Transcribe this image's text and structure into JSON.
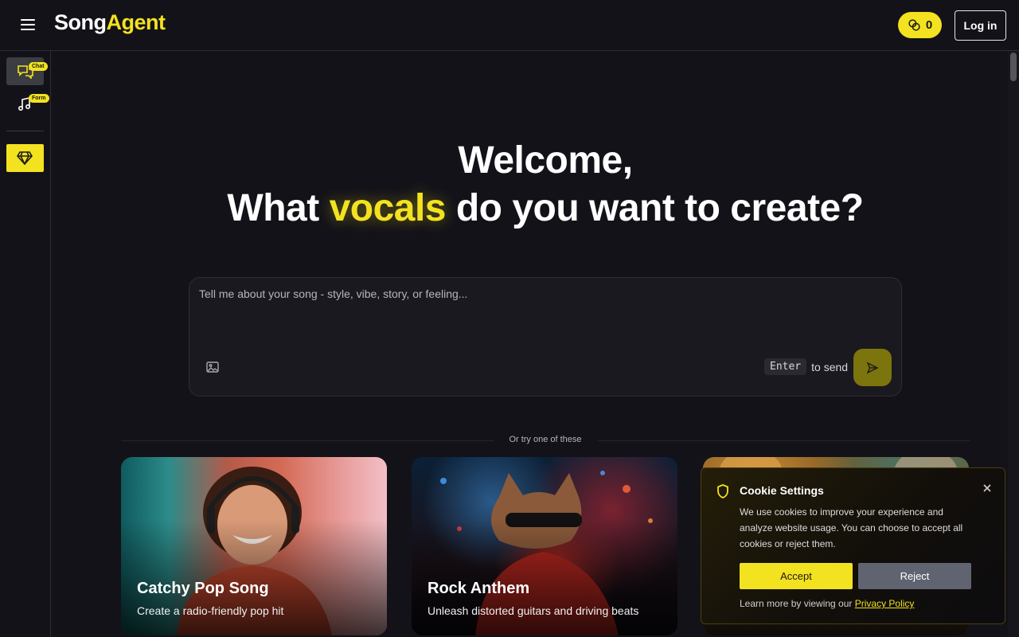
{
  "header": {
    "logo_part1": "Song",
    "logo_part2": "Agent",
    "credits_count": "0",
    "login_label": "Log in"
  },
  "sidebar": {
    "items": [
      {
        "badge": "Chat",
        "icon": "chat-bubbles-icon"
      },
      {
        "badge": "Form",
        "icon": "music-note-icon"
      }
    ],
    "premium_icon": "diamond-icon"
  },
  "hero": {
    "line1": "Welcome,",
    "line2_pre": "What ",
    "line2_accent": "vocals",
    "line2_post": " do you want to create?"
  },
  "prompt": {
    "placeholder": "Tell me about your song - style, vibe, story, or feeling...",
    "value": "",
    "enter_key": "Enter",
    "send_hint": "to send"
  },
  "try_section": {
    "label": "Or try one of these",
    "cards": [
      {
        "title": "Catchy Pop Song",
        "subtitle": "Create a radio-friendly pop hit"
      },
      {
        "title": "Rock Anthem",
        "subtitle": "Unleash distorted guitars and driving beats"
      },
      {
        "title": "",
        "subtitle": ""
      }
    ]
  },
  "cookie": {
    "title": "Cookie Settings",
    "text": "We use cookies to improve your experience and analyze website usage. You can choose to accept all cookies or reject them.",
    "accept_label": "Accept",
    "reject_label": "Reject",
    "footer_prefix": "Learn more by viewing our ",
    "policy_link": "Privacy Policy"
  },
  "colors": {
    "accent": "#f3e21f",
    "background": "#131219",
    "panel": "#1a1920",
    "reject_button": "#5f6470"
  }
}
